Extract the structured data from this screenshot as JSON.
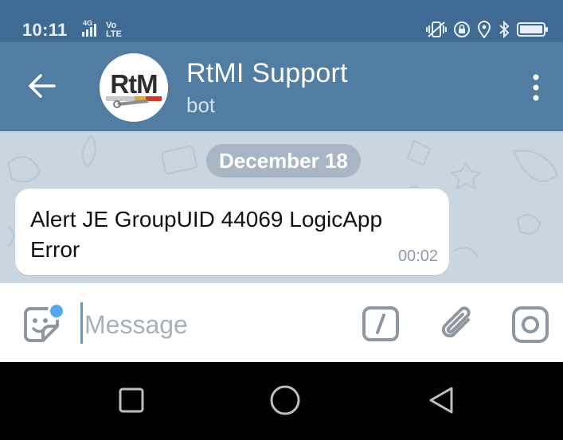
{
  "status_bar": {
    "time": "10:11",
    "network_4g": "4G",
    "volte_top": "Vo",
    "volte_bottom": "LTE",
    "icons": [
      "vibrate-icon",
      "lock-rotation-icon",
      "location-icon",
      "bluetooth-icon",
      "battery-icon"
    ]
  },
  "header": {
    "title": "RtMI Support",
    "subtitle": "bot",
    "avatar_text": "RtM",
    "back_icon": "arrow-left-icon",
    "menu_icon": "more-vertical-icon"
  },
  "chat": {
    "date_label": "December 18",
    "messages": [
      {
        "text": "Alert JE GroupUID 44069 LogicApp Error",
        "time": "00:02"
      }
    ]
  },
  "input_bar": {
    "placeholder": "Message",
    "value": "",
    "icons": [
      "sticker-icon",
      "bot-command-icon",
      "paperclip-icon",
      "camera-icon"
    ]
  },
  "nav_bar": {
    "icons": [
      "recents-square-icon",
      "home-circle-icon",
      "back-triangle-icon"
    ]
  },
  "colors": {
    "status_bar": "#3f6a93",
    "header": "#517da2",
    "chat_background": "#cad6df",
    "date_pill": "#a7b6c4",
    "accent": "#52a8ea",
    "icon_gray": "#8e979f"
  }
}
